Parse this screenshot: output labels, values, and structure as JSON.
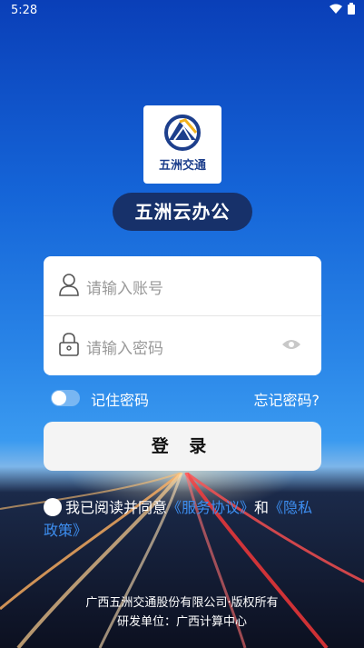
{
  "status_bar": {
    "time": "5:28",
    "wifi_icon": "wifi-icon",
    "battery_icon": "battery-icon"
  },
  "logo": {
    "text": "五洲交通",
    "brand_color": "#1d3f8c",
    "accent_color": "#f2b21d"
  },
  "app_title": "五洲云办公",
  "form": {
    "username_placeholder": "请输入账号",
    "password_placeholder": "请输入密码",
    "remember_label": "记住密码",
    "remember_checked": false,
    "forgot_label": "忘记密码?",
    "login_label": "登 录"
  },
  "agreement": {
    "checked": false,
    "prefix": "我已阅读并同意",
    "service_link": "《服务协议》",
    "and": "和",
    "privacy_link": "《隐私政策》"
  },
  "footer": {
    "line1": "广西五洲交通股份有限公司·版权所有",
    "line2": "研发单位：广西计算中心"
  },
  "colors": {
    "link": "#3d8ef0",
    "title_pill": "#17316a"
  }
}
